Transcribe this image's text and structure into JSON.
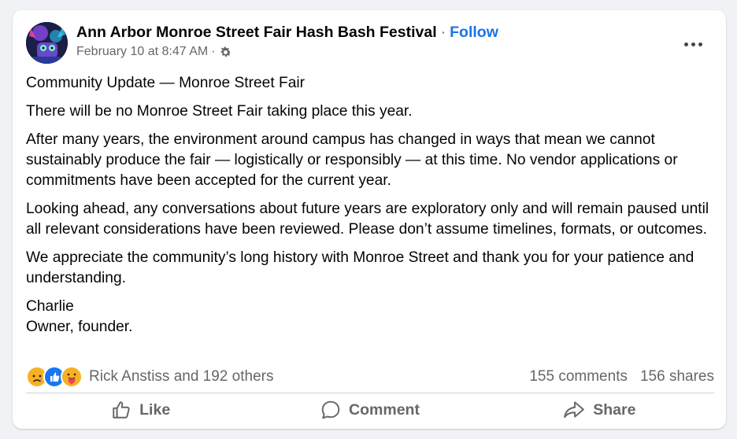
{
  "post": {
    "page_name": "Ann Arbor Monroe Street Fair Hash Bash Festival",
    "separator": "·",
    "follow_label": "Follow",
    "timestamp": "February 10 at 8:47 AM",
    "audience_separator": "·",
    "audience_icon": "gear-icon",
    "more_icon": "more-options-icon",
    "paragraphs": [
      "Community Update — Monroe Street Fair",
      "There will be no Monroe Street Fair taking place this year.",
      "After many years, the environment around campus has changed in ways that mean we cannot sustainably produce the fair — logistically or responsibly — at this time. No vendor applications or commitments have been accepted for the current year.",
      "Looking ahead, any conversations about future years are exploratory only and will remain paused until all relevant considerations have been reviewed. Please don’t assume timelines, formats, or outcomes.",
      "We appreciate the community’s long history with Monroe Street and thank you for your patience and understanding."
    ],
    "signature_name": "Charlie",
    "signature_title": "Owner, founder."
  },
  "reactions": {
    "icons": [
      "sad-reaction-icon",
      "like-reaction-icon",
      "care-reaction-icon"
    ],
    "names_text": "Rick Anstiss and 192 others",
    "comments_text": "155 comments",
    "shares_text": "156 shares"
  },
  "actions": {
    "like_label": "Like",
    "comment_label": "Comment",
    "share_label": "Share"
  },
  "colors": {
    "link_blue": "#1b74e4",
    "secondary_text": "#65676b",
    "background": "#f0f2f5",
    "like_blue": "#1877f2",
    "reaction_yellow": "#f7b125"
  }
}
